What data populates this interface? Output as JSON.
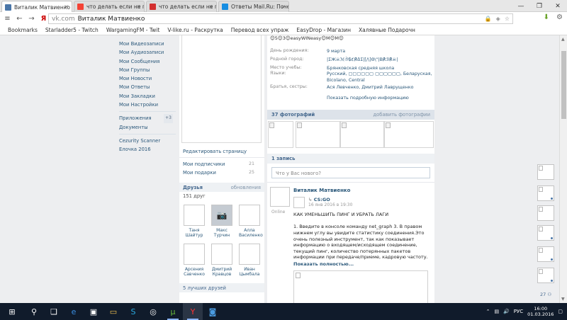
{
  "browser": {
    "tabs": [
      {
        "title": "Виталик Матвиенко",
        "favicon_color": "#4a76a8",
        "active": true
      },
      {
        "title": "что делать если не гр",
        "favicon_color": "#f44336",
        "active": false
      },
      {
        "title": "что делать если не гр",
        "favicon_color": "#d32f2f",
        "active": false
      },
      {
        "title": "Ответы Mail.Ru: Поче",
        "favicon_color": "#168de2",
        "active": false
      }
    ],
    "url_host": "vk.com",
    "url_title": "Виталик Матвиенко",
    "bookmarks": [
      "Bookmarks",
      "Starladder5 - Twitch",
      "WargamingFM - Twit",
      "V-like.ru - Раскрутка",
      "Перевод всех упраж",
      "EasyDrop - Магазин",
      "Халявные Подарочн"
    ]
  },
  "left_nav": {
    "items": [
      "Мои Видеозаписи",
      "Мои Аудиозаписи",
      "Мои Сообщения",
      "Мои Группы",
      "Мои Новости",
      "Мои Ответы",
      "Мои Закладки",
      "Мои Настройки"
    ],
    "apps": [
      {
        "label": "Приложения",
        "badge": "+3"
      },
      {
        "label": "Документы",
        "badge": ""
      }
    ],
    "extras": [
      "Cezurity Scanner",
      "Елочка 2016"
    ]
  },
  "profile_col": {
    "edit_page": "Редактировать страницу",
    "subscribers": {
      "label": "Мои подписчики",
      "count": "21"
    },
    "gifts": {
      "label": "Мои подарки",
      "count": "25"
    },
    "friends": {
      "title": "Друзья",
      "action": "обновления",
      "count": "151 друг"
    },
    "friend_list": [
      {
        "first": "Таня",
        "last": "Шайтур"
      },
      {
        "first": "Макс",
        "last": "Турчин"
      },
      {
        "first": "Алла",
        "last": "Василенко"
      },
      {
        "first": "Арсения",
        "last": "Савченко"
      },
      {
        "first": "Дмитрий",
        "last": "Кравцов"
      },
      {
        "first": "Иван",
        "last": "Цымбала"
      }
    ],
    "best_friends": "5 лучших друзей"
  },
  "profile_info": {
    "status_line": "😊5😊3😊easyWINeasy😊M😊M😊",
    "rows": [
      {
        "key": "День рождения:",
        "value": "9 марта"
      },
      {
        "key": "Родной город:",
        "value": "|ΣЖ☠ℳঔ₲ℭ℟ἄΣ|[/\\]Θ\\\"|Β℟ℬ℟☠|"
      },
      {
        "key": "Место учебы:",
        "value": "Брянковская средняя школа"
      },
      {
        "key": "Языки:",
        "value": "Русский, ▢▢▢▢▢▢ ▢▢▢▢▢▢, Беларуская, Bicolano, Central"
      },
      {
        "key": "Братья, сестры:",
        "value": "Ася Левченко, Дмитрий Лаврущенко"
      }
    ],
    "show_more": "Показать подробную информацию",
    "photos": {
      "title": "37 фотографий",
      "action": "добавить фотографии"
    },
    "wall": {
      "count": "1 запись",
      "placeholder": "Что у Вас нового?"
    }
  },
  "post": {
    "author": "Виталик Матвиенко",
    "online": "Online",
    "repost_source": "CS:GO",
    "date": "16 янв 2016 в 19:30",
    "title": "КАК УМЕНЬШИТЬ ПИНГ И УБРАТЬ ЛАГИ",
    "body": "1. Введите в консоле команду net_graph 3. В правом нижнем углу вы увидите статистику соединения.Это очень полезный инструмент, так как показывает информацию о входящем/исходящем соединение, текущий пинг, количество потерянных пакетов информации при передаче/приеме, кадровую частоту.",
    "show_full": "Показать полностью..."
  },
  "rail": {
    "count": "27"
  },
  "taskbar": {
    "icons": [
      "windows-logo",
      "search",
      "task-view",
      "edge",
      "store",
      "explorer",
      "skype",
      "steam",
      "utorrent",
      "yandex-browser",
      "app"
    ],
    "lang": "РУС",
    "time": "16:00",
    "date": "01.03.2016"
  }
}
